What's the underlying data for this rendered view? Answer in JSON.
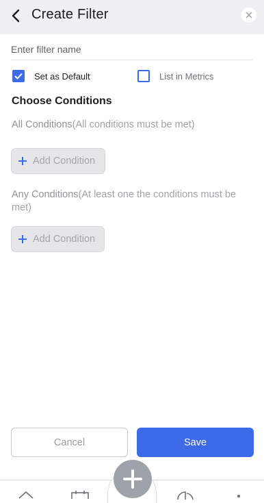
{
  "header": {
    "title": "Create Filter",
    "back_icon": "chevron-left-icon",
    "close_icon": "close-icon"
  },
  "filter_name": {
    "placeholder": "Enter filter name",
    "value": ""
  },
  "options": {
    "set_default": {
      "label": "Set as Default",
      "checked": true
    },
    "list_in_metrics": {
      "label": "List in Metrics",
      "checked": false
    }
  },
  "conditions": {
    "title": "Choose Conditions",
    "all": {
      "label": "All Conditions",
      "note": "(All conditions must be met)",
      "add_label": "Add Condition"
    },
    "any": {
      "label": "Any Conditions",
      "note": "(At least one the conditions must be met)",
      "add_label": "Add Condition"
    }
  },
  "actions": {
    "cancel": "Cancel",
    "save": "Save"
  },
  "tabbar": {
    "icons": [
      "home-icon",
      "calendar-icon",
      "add-icon",
      "chart-icon",
      "more-icon"
    ]
  },
  "colors": {
    "accent": "#3d6be8",
    "header_bg": "#eef0f4",
    "fab": "#9ea3aa"
  }
}
